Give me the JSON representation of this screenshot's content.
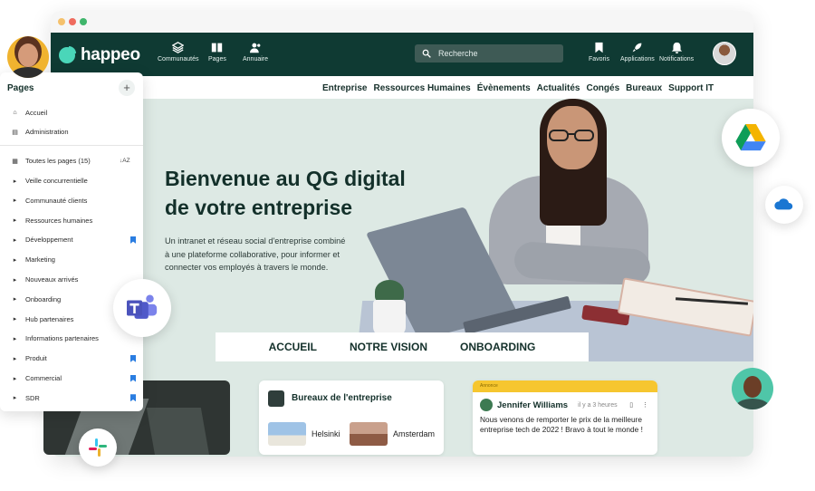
{
  "window": {
    "controls": [
      "close",
      "minimize",
      "maximize"
    ]
  },
  "brand": {
    "name": "happeo"
  },
  "topnav": {
    "items": [
      {
        "label": "Communautés",
        "icon": "layers-icon"
      },
      {
        "label": "Pages",
        "icon": "book-icon"
      },
      {
        "label": "Annuaire",
        "icon": "people-icon"
      }
    ],
    "search_placeholder": "Recherche",
    "right_items": [
      {
        "label": "Favoris",
        "icon": "bookmark-icon"
      },
      {
        "label": "Applications",
        "icon": "rocket-icon"
      },
      {
        "label": "Notifications",
        "icon": "bell-icon"
      }
    ]
  },
  "subnav": [
    "Entreprise",
    "Ressources Humaines",
    "Évènements",
    "Actualités",
    "Congés",
    "Bureaux",
    "Support IT"
  ],
  "hero": {
    "title": "Bienvenue au QG digital de votre entreprise",
    "text": "Un intranet et réseau social d'entreprise combiné à une plateforme collaborative, pour informer et connecter vos employés à travers le monde.",
    "tabs": [
      "ACCUEIL",
      "NOTRE VISION",
      "ONBOARDING"
    ]
  },
  "offices": {
    "title": "Bureaux de l'entreprise",
    "cities": [
      "Helsinki",
      "Amsterdam"
    ]
  },
  "post": {
    "badge": "Annonce",
    "author": "Jennifer Williams",
    "time": "il y a 3 heures",
    "text": "Nous venons de remporter le prix de la meilleure entreprise tech de 2022 ! Bravo à tout le monde !"
  },
  "sidebar": {
    "title": "Pages",
    "top_items": [
      {
        "label": "Accueil",
        "icon": "home-icon"
      },
      {
        "label": "Administration",
        "icon": "document-icon"
      }
    ],
    "all_pages_label": "Toutes les pages (15)",
    "sort_label": "↓AZ",
    "pages": [
      {
        "label": "Veille concurrentielle",
        "bookmarked": false
      },
      {
        "label": "Communauté clients",
        "bookmarked": false
      },
      {
        "label": "Ressources humaines",
        "bookmarked": false
      },
      {
        "label": "Développement",
        "bookmarked": true
      },
      {
        "label": "Marketing",
        "bookmarked": false
      },
      {
        "label": "Nouveaux arrivés",
        "bookmarked": false
      },
      {
        "label": "Onboarding",
        "bookmarked": false
      },
      {
        "label": "Hub partenaires",
        "bookmarked": false
      },
      {
        "label": "Informations partenaires",
        "bookmarked": false
      },
      {
        "label": "Produit",
        "bookmarked": true
      },
      {
        "label": "Commercial",
        "bookmarked": true
      },
      {
        "label": "SDR",
        "bookmarked": true
      }
    ]
  },
  "integrations": [
    "google-drive-icon",
    "onedrive-icon",
    "microsoft-teams-icon",
    "slack-icon"
  ],
  "colors": {
    "nav_bg": "#0f3a33",
    "accent": "#4ad6b9",
    "hero_bg": "#dde9e4",
    "announce": "#f6c62f",
    "bookmark": "#2a7de1"
  }
}
